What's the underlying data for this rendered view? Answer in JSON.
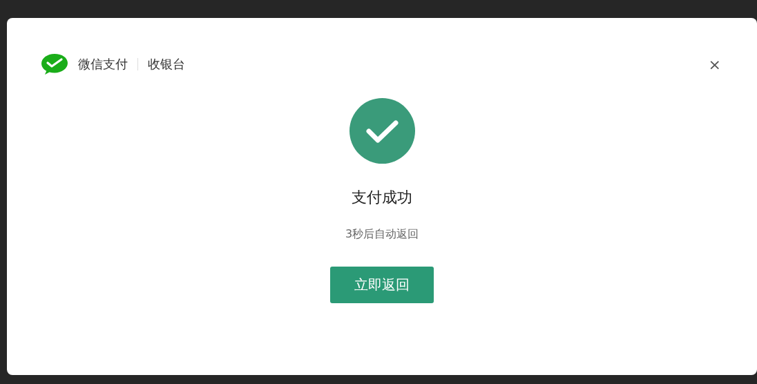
{
  "dialog": {
    "brand": "微信支付",
    "section": "收银台",
    "close": "×"
  },
  "result": {
    "title": "支付成功",
    "countdown": "3秒后自动返回",
    "button": "立即返回"
  }
}
